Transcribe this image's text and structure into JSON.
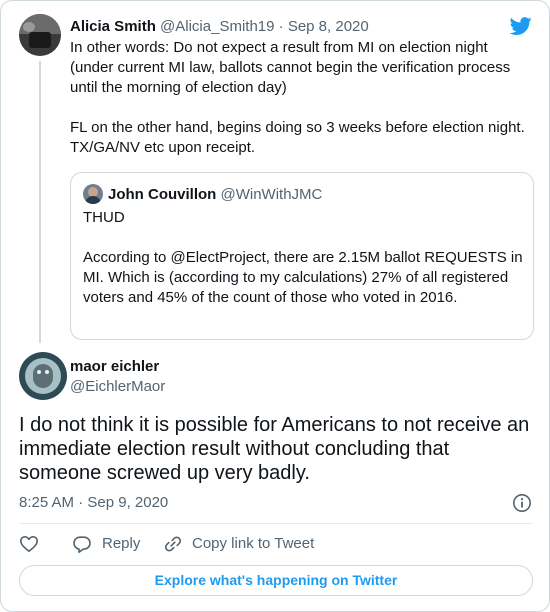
{
  "parent_tweet": {
    "name": "Alicia Smith",
    "handle": "@Alicia_Smith19",
    "separator": " · ",
    "date": "Sep 8, 2020",
    "text": "In other words: Do not expect a result from MI on election night (under current MI law, ballots cannot begin the verification process until the morning of election day)\n\nFL on the other hand, begins doing so 3 weeks before election night. TX/GA/NV etc upon receipt."
  },
  "quoted_tweet": {
    "name": "John Couvillon",
    "handle": "@WinWithJMC",
    "text": "THUD\n\nAccording to @ElectProject, there are 2.15M ballot REQUESTS in MI. Which is (according to my calculations) 27% of all registered voters and 45% of the count of those who voted in 2016."
  },
  "main_tweet": {
    "name": "maor eichler",
    "handle": "@EichlerMaor",
    "text": "I do not think it is possible for Americans to not receive an immediate election result without concluding that someone screwed up very badly.",
    "timestamp": "8:25 AM · Sep 9, 2020"
  },
  "actions": {
    "reply_label": "Reply",
    "copy_link_label": "Copy link to Tweet"
  },
  "explore": {
    "label": "Explore what's happening on Twitter"
  },
  "icons": {
    "brand": "twitter-bird-icon",
    "info": "info-icon",
    "like": "heart-icon",
    "reply": "reply-icon",
    "link": "link-icon"
  },
  "colors": {
    "brand_blue": "#1d9bf0",
    "text_primary": "#0f1419",
    "text_secondary": "#536471",
    "border": "#cfd9de"
  }
}
